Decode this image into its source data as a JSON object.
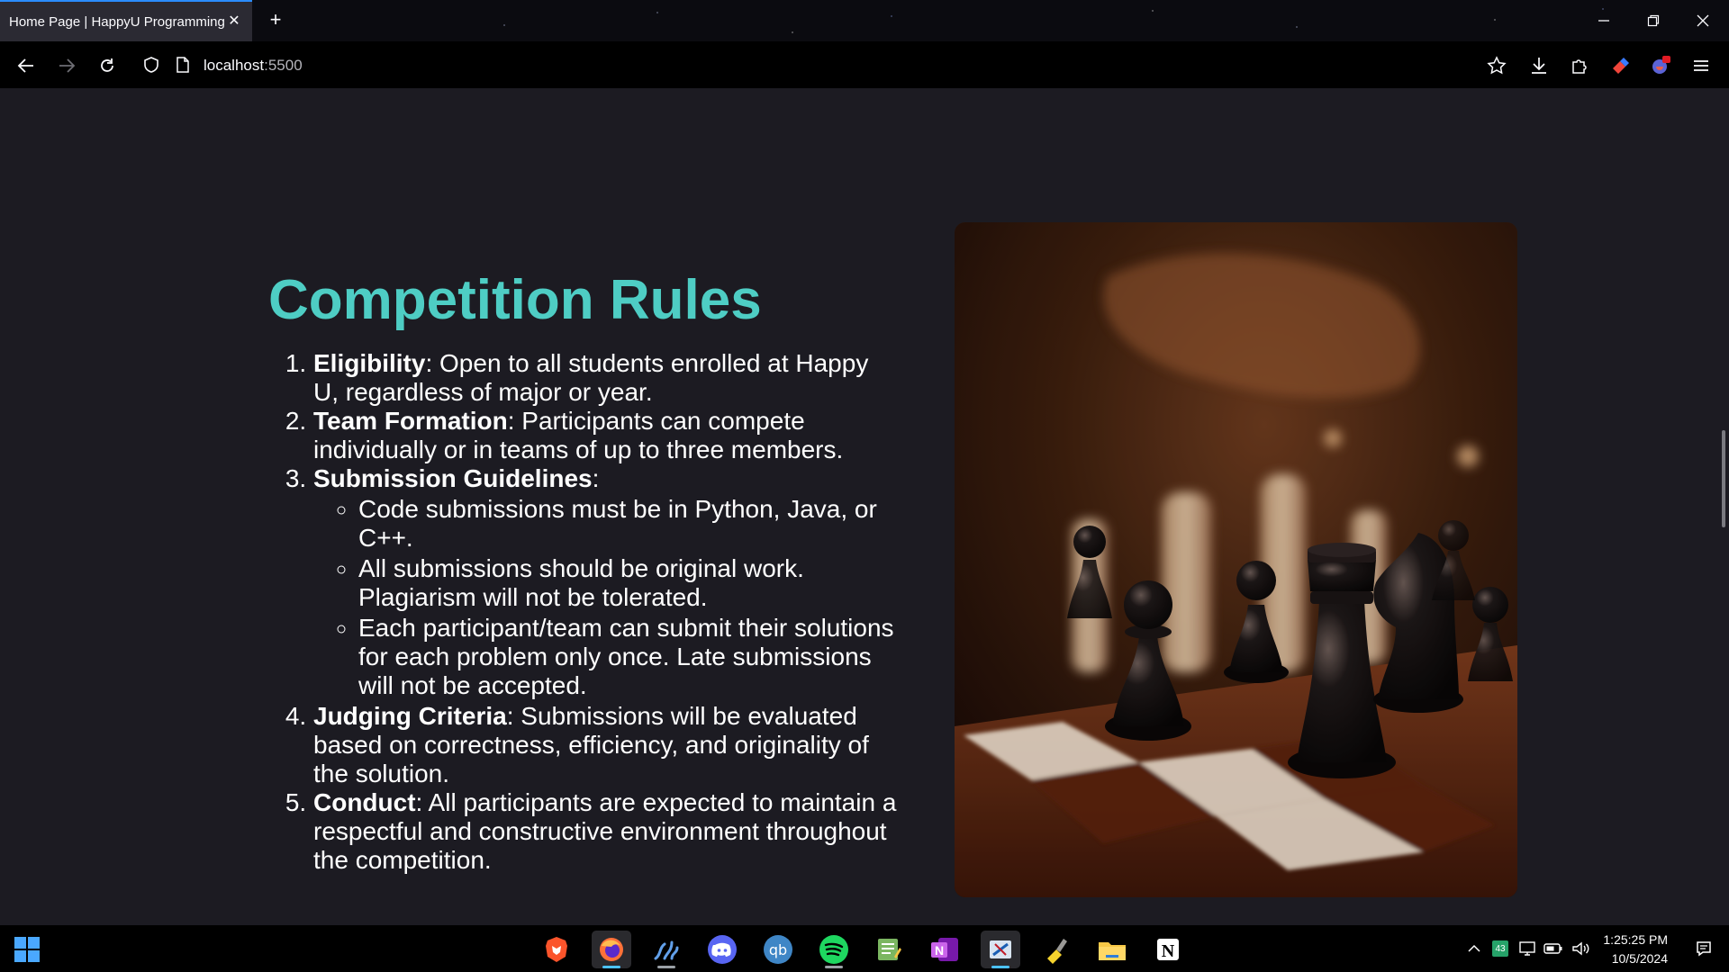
{
  "browser": {
    "tab_title": "Home Page | HappyU Programming",
    "url_host": "localhost",
    "url_port": ":5500"
  },
  "page": {
    "heading": "Competition Rules",
    "rules": [
      {
        "title": "Eligibility",
        "text": ": Open to all students enrolled at Happy U, regardless of major or year."
      },
      {
        "title": "Team Formation",
        "text": ": Participants can compete individually or in teams of up to three members."
      },
      {
        "title": "Submission Guidelines",
        "text": ":",
        "sub": [
          "Code submissions must be in Python, Java, or C++.",
          "All submissions should be original work. Plagiarism will not be tolerated.",
          "Each participant/team can submit their solutions for each problem only once. Late submissions will not be accepted."
        ]
      },
      {
        "title": "Judging Criteria",
        "text": ": Submissions will be evaluated based on correctness, efficiency, and originality of the solution."
      },
      {
        "title": "Conduct",
        "text": ": All participants are expected to maintain a respectful and constructive environment throughout the competition."
      }
    ]
  },
  "taskbar": {
    "apps": [
      "brave-icon",
      "firefox-icon",
      "vscode-icon",
      "discord-icon",
      "qbittorrent-icon",
      "spotify-icon",
      "notepad-icon",
      "onenote-icon",
      "snipping-tool-icon",
      "cleaner-icon",
      "file-explorer-icon",
      "notion-icon"
    ],
    "tray_badge": "43",
    "time": "1:25:25 PM",
    "date": "10/5/2024"
  },
  "colors": {
    "accent": "#4ecdc4",
    "tab_highlight": "#2b8cff",
    "page_bg": "#1c1b22"
  }
}
